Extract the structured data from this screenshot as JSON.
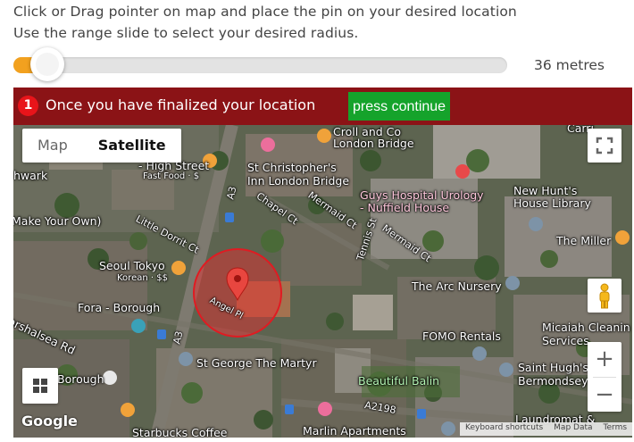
{
  "instructions": {
    "line1": "Click or Drag pointer on map and place the pin on your desired location",
    "line2": "Use the range slide to select your desired radius."
  },
  "radius": {
    "value_fraction": 0.02,
    "display": "36 metres",
    "accent_color": "#f2a11f"
  },
  "banner": {
    "step_number": "1",
    "message": "Once you have finalized your location",
    "continue_label": "press continue",
    "bg_color": "#8b1316",
    "button_color": "#15a32b"
  },
  "map": {
    "map_type_options": [
      "Map",
      "Satellite"
    ],
    "selected_map_type": "Satellite",
    "zoom_in": "+",
    "zoom_out": "−",
    "google_logo": "Google",
    "attribution": [
      "Keyboard shortcuts",
      "Map Data",
      "Terms"
    ],
    "pin_label": "Angel Pl",
    "labels": {
      "croll_co": "Croll and Co",
      "london_bridge": "London Bridge",
      "carrie": "Carri",
      "high_street": "- High Street",
      "fast_food": "Fast Food · $",
      "st_christophers": "St Christopher's",
      "inn_london_bridge": "Inn London Bridge",
      "guys_hospital": "Guys Hospital Urology",
      "nuffield_house": "- Nuffield House",
      "new_hunts": "New Hunt's",
      "house_library": "House Library",
      "hwark": "hwark",
      "make_your_own": "Make Your Own)",
      "chapel_ct": "Chapel Ct",
      "mermaid_ct_1": "Mermaid Ct",
      "mermaid_ct_2": "Mermaid Ct",
      "tennis_st": "Tennis St",
      "little_dorrit": "Little Dorrit Ct",
      "the_miller": "The Miller",
      "seoul_tokyo": "Seoul Tokyo",
      "korean": "Korean · $$",
      "a3_top": "A3",
      "a3_bottom": "A3",
      "the_arc_nursery": "The Arc Nursery",
      "fora_borough": "Fora - Borough",
      "marshalsea_rd": "arshalsea Rd",
      "fomo_rentals": "FOMO Rentals",
      "micaiah": "Micaiah Cleanin",
      "services": "Services",
      "st_george": "St George The Martyr",
      "saint_hughs": "Saint Hugh's",
      "bermondsey": "Bermondsey",
      "borough": "Borough",
      "beautiful_balin": "Beautiful Balin",
      "a2198": "A2198",
      "laundromat": "Laundromat &",
      "starbucks": "Starbucks Coffee",
      "marlin_apartments": "Marlin Apartments"
    }
  }
}
